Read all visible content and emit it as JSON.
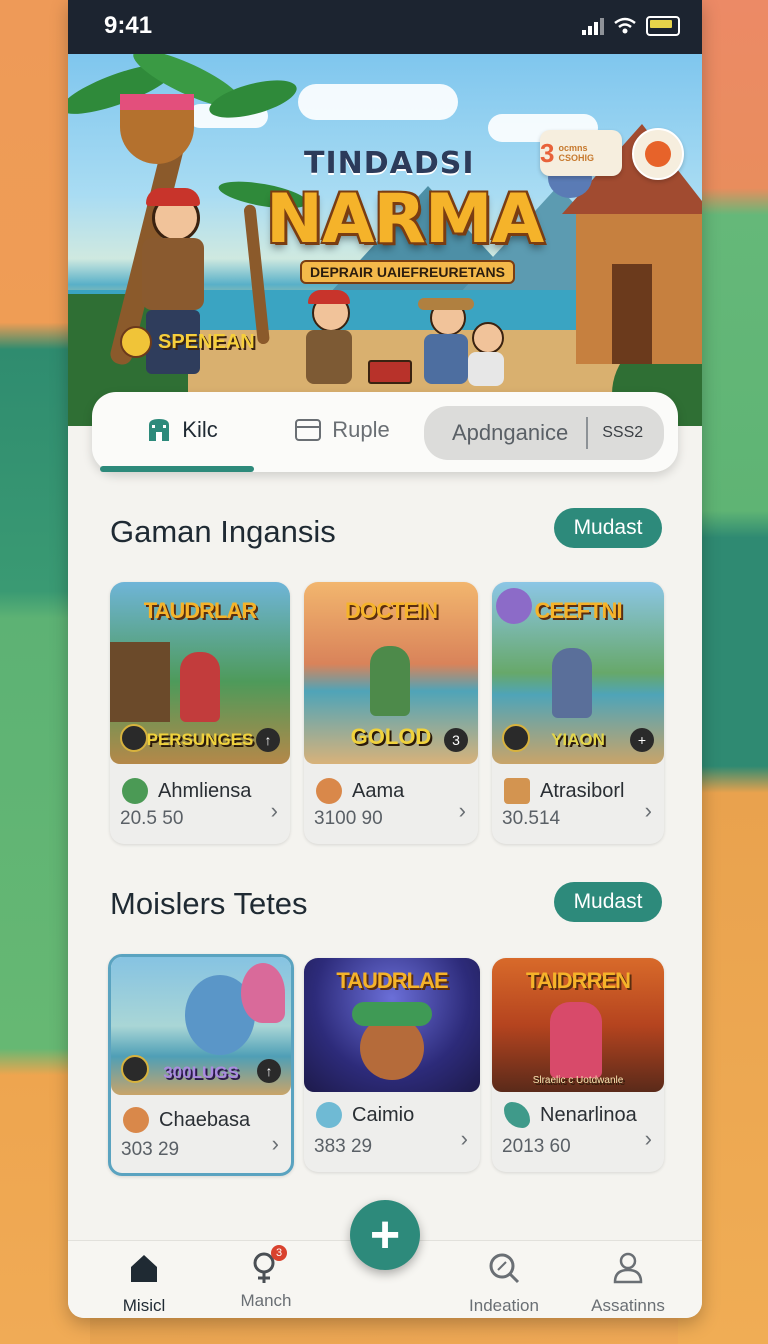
{
  "status_bar": {
    "time": "9:41"
  },
  "hero": {
    "title_top": "TINDADSI",
    "title": "NARMA",
    "subtitle": "DEPRAIR UAIEFREURETANS",
    "badge": "SPENEAN",
    "coins": {
      "value": "3",
      "label": "ocmns CSOHIG"
    }
  },
  "tabs": [
    {
      "label": "Kilc",
      "icon": "building-icon",
      "active": true
    },
    {
      "label": "Ruple",
      "icon": "card-icon",
      "active": false
    },
    {
      "label": "Apdnganice",
      "extra": "SSS2",
      "active": false
    }
  ],
  "sections": [
    {
      "title": "Gaman Ingansis",
      "more_label": "Mudast",
      "cards": [
        {
          "art_title": "TAUDRLAR",
          "art_sub": "PERSUNGES",
          "corner": "↑",
          "name": "Ahmliensa",
          "number": "20.5 50"
        },
        {
          "art_title": "DOCTEIN",
          "art_sub": "GOLOD",
          "corner": "3",
          "name": "Aama",
          "number": "3100 90"
        },
        {
          "art_title": "CEEFTNI",
          "art_sub": "YIAON",
          "corner": "+",
          "name": "Atrasiborl",
          "number": "30.514"
        }
      ]
    },
    {
      "title": "Moislers Tetes",
      "more_label": "Mudast",
      "cards": [
        {
          "art_title": "",
          "art_sub": "300LUGS",
          "corner": "↑",
          "name": "Chaebasa",
          "number": "303 29"
        },
        {
          "art_title": "TAUDRLAE",
          "art_sub": "",
          "corner": "",
          "name": "Caimio",
          "number": "383 29"
        },
        {
          "art_title": "TAIDRREN",
          "art_sub": "Slraelic c Uotdwanle",
          "corner": "",
          "name": "Nenarlinoa",
          "number": "2013 60"
        }
      ]
    }
  ],
  "bottom_nav": [
    {
      "label": "Misicl",
      "icon": "home-icon",
      "active": true
    },
    {
      "label": "Manch",
      "icon": "female-icon",
      "badge": "3"
    },
    {
      "label": "Indeation",
      "icon": "search-icon"
    },
    {
      "label": "Assatinns",
      "icon": "person-icon"
    }
  ],
  "fab_label": "+",
  "colors": {
    "accent": "#2d8a7b",
    "status_bar": "#1c2430",
    "hero_title": "#f5b32a"
  }
}
